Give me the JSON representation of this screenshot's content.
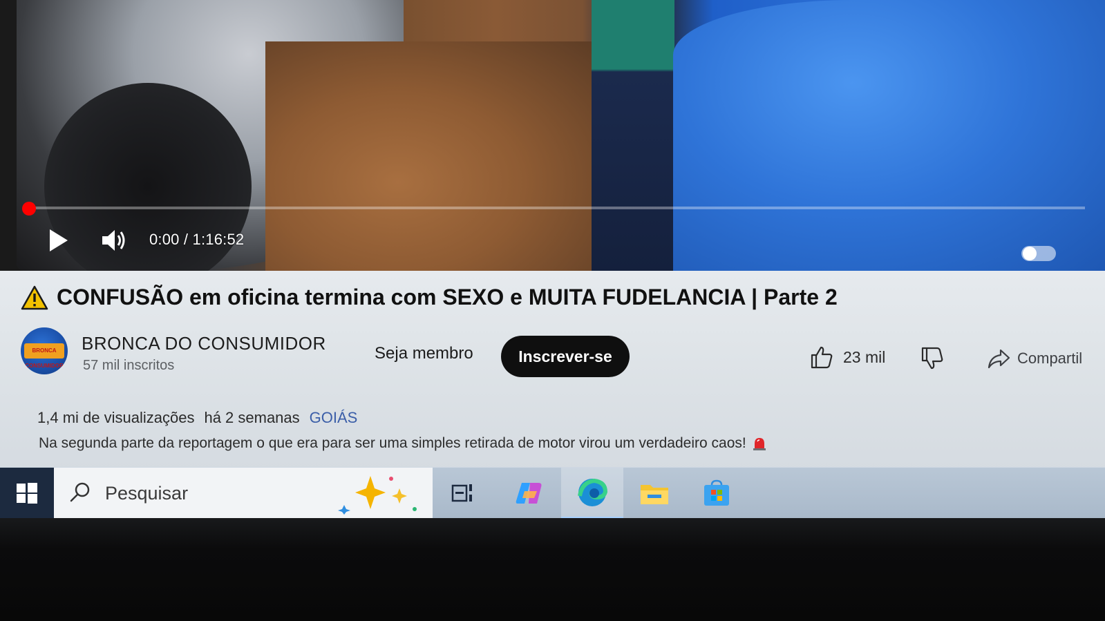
{
  "player": {
    "progress_fraction": 0.0,
    "time_display": "0:00 / 1:16:52",
    "accent_color": "#ff0000",
    "icons": [
      "play-icon",
      "volume-icon",
      "autoplay-toggle"
    ]
  },
  "video": {
    "title": "CONFUSÃO em oficina termina com SEXO e MUITA FUDELANCIA | Parte 2",
    "title_icon": "warning-icon"
  },
  "channel": {
    "name": "BRONCA DO CONSUMIDOR",
    "subscribers": "57 mil inscritos",
    "avatar_text": "BRONCA CONSUMIDOR",
    "join_label": "Seja membro",
    "subscribe_label": "Inscrever-se"
  },
  "actions": {
    "like_count": "23 mil",
    "share_label": "Compartil"
  },
  "meta": {
    "views": "1,4 mi de visualizações",
    "age": "há 2 semanas",
    "hashtag": "GOIÁS",
    "description": "Na segunda parte da reportagem o que era para ser uma simples retirada de motor virou um verdadeiro caos!"
  },
  "taskbar": {
    "search_placeholder": "Pesquisar",
    "items": [
      "windows-start-icon",
      "search-icon",
      "copilot-sparkle-icon",
      "task-view-icon",
      "copilot-icon",
      "edge-icon",
      "file-explorer-icon",
      "microsoft-store-icon"
    ],
    "active_item": "edge-icon"
  }
}
